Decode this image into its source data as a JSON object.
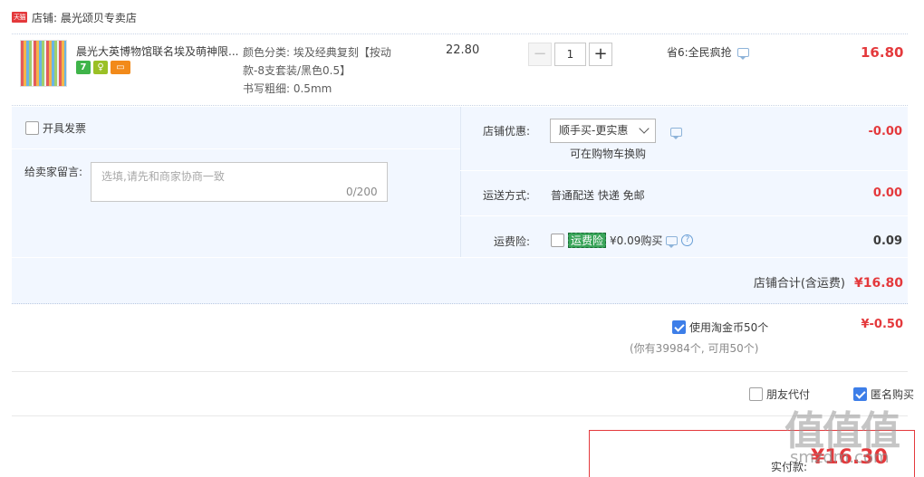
{
  "shop": {
    "logo_text": "天猫",
    "name_label": "店铺: 晨光颂贝专卖店"
  },
  "item": {
    "title": "晨光大英博物馆联名埃及萌神限...",
    "badges": [
      "7",
      "♀",
      "▭"
    ],
    "sku_line1": "颜色分类: 埃及经典复刻【按动",
    "sku_line2": "款-8支套装/黑色0.5】",
    "sku_line3": "书写粗细: 0.5mm",
    "unit_price": "22.80",
    "quantity": "1",
    "qty_minus": "−",
    "qty_plus": "+",
    "promo_text": "省6:全民疯抢",
    "total": "16.80"
  },
  "options": {
    "invoice_label": "开具发票",
    "message_label": "给卖家留言:",
    "message_placeholder": "选填,请先和商家协商一致",
    "message_count": "0/200",
    "shop_discount_label": "店铺优惠:",
    "shop_discount_selected": "顺手买-更实惠",
    "shop_discount_hint": "可在购物车换购",
    "shop_discount_value": "-0.00",
    "shipping_label": "运送方式:",
    "shipping_value_text": "普通配送 快递 免邮",
    "shipping_value": "0.00",
    "insurance_label": "运费险:",
    "insurance_tag": "运费险",
    "insurance_price": "¥0.09购买",
    "insurance_value": "0.09",
    "subtotal_label": "店铺合计(含运费)",
    "subtotal_value": "¥16.80"
  },
  "coins": {
    "label": "使用淘金币50个",
    "note": "(你有39984个, 可用50个)",
    "value": "¥-0.50"
  },
  "payment": {
    "friend_pay_label": "朋友代付",
    "anonymous_label": "匿名购买",
    "total_label": "实付款:",
    "total_value": "¥16.30"
  },
  "watermark": {
    "main": "值值值",
    "sub": "smzdm.com"
  },
  "colors": {
    "accent_red": "#e4393c",
    "panel_bg": "#f2f7ff",
    "checkbox_blue": "#3d7ee8"
  }
}
